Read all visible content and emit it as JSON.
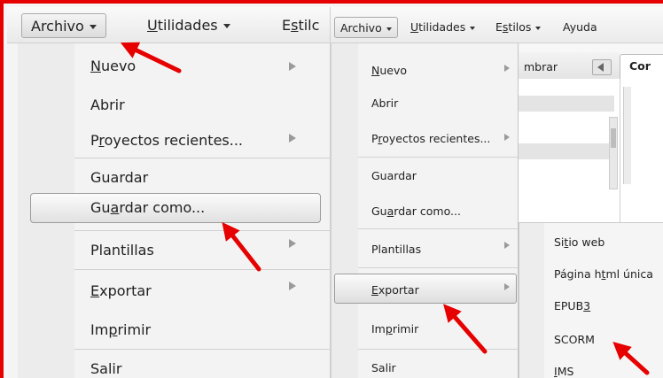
{
  "colors": {
    "frame": "#e60000",
    "annotation_arrow": "#e60000"
  },
  "left": {
    "menubar": {
      "archivo": {
        "pre": "Archivo",
        "ul": "",
        "post": ""
      },
      "utilidades": {
        "pre": "",
        "ul": "U",
        "post": "tilidades"
      },
      "estilos": {
        "pre": "E",
        "ul": "s",
        "post": "tilc"
      }
    },
    "menu": {
      "nuevo": {
        "pre": "",
        "ul": "N",
        "post": "uevo"
      },
      "abrir": {
        "pre": "Abrir",
        "ul": "",
        "post": ""
      },
      "recientes": {
        "pre": "P",
        "ul": "r",
        "post": "oyectos recientes..."
      },
      "guardar": {
        "pre": "Guardar",
        "ul": "",
        "post": ""
      },
      "guardar_como": {
        "pre": "Gu",
        "ul": "a",
        "post": "rdar como..."
      },
      "plantillas": {
        "pre": "Plantillas",
        "ul": "",
        "post": ""
      },
      "exportar": {
        "pre": "",
        "ul": "E",
        "post": "xportar"
      },
      "imprimir": {
        "pre": "Im",
        "ul": "p",
        "post": "rimir"
      },
      "salir": {
        "pre": "Salir",
        "ul": "",
        "post": ""
      }
    }
  },
  "right": {
    "menubar": {
      "archivo": {
        "pre": "Archivo",
        "ul": "",
        "post": ""
      },
      "utilidades": {
        "pre": "",
        "ul": "U",
        "post": "tilidades"
      },
      "estilos": {
        "pre": "E",
        "ul": "s",
        "post": "tilos"
      },
      "ayuda": {
        "pre": "Ayuda",
        "ul": "",
        "post": ""
      }
    },
    "background": {
      "panel_text": "mbrar",
      "tab_label": "Cor"
    },
    "menu": {
      "nuevo": {
        "pre": "",
        "ul": "N",
        "post": "uevo"
      },
      "abrir": {
        "pre": "Abrir",
        "ul": "",
        "post": ""
      },
      "recientes": {
        "pre": "P",
        "ul": "r",
        "post": "oyectos recientes..."
      },
      "guardar": {
        "pre": "Guardar",
        "ul": "",
        "post": ""
      },
      "guardar_como": {
        "pre": "Gu",
        "ul": "a",
        "post": "rdar como..."
      },
      "plantillas": {
        "pre": "Plantillas",
        "ul": "",
        "post": ""
      },
      "exportar": {
        "pre": "",
        "ul": "E",
        "post": "xportar"
      },
      "imprimir": {
        "pre": "Im",
        "ul": "p",
        "post": "rimir"
      },
      "salir": {
        "pre": "Salir",
        "ul": "",
        "post": ""
      }
    },
    "submenu": {
      "sitio_web": {
        "pre": "Si",
        "ul": "t",
        "post": "io web"
      },
      "pagina_unica": {
        "pre": "Página h",
        "ul": "t",
        "post": "ml única"
      },
      "epub3": {
        "pre": "EPUB",
        "ul": "3",
        "post": ""
      },
      "scorm": {
        "pre": "SCORM",
        "ul": "",
        "post": ""
      },
      "ims": {
        "pre": "",
        "ul": "I",
        "post": "MS"
      }
    }
  }
}
